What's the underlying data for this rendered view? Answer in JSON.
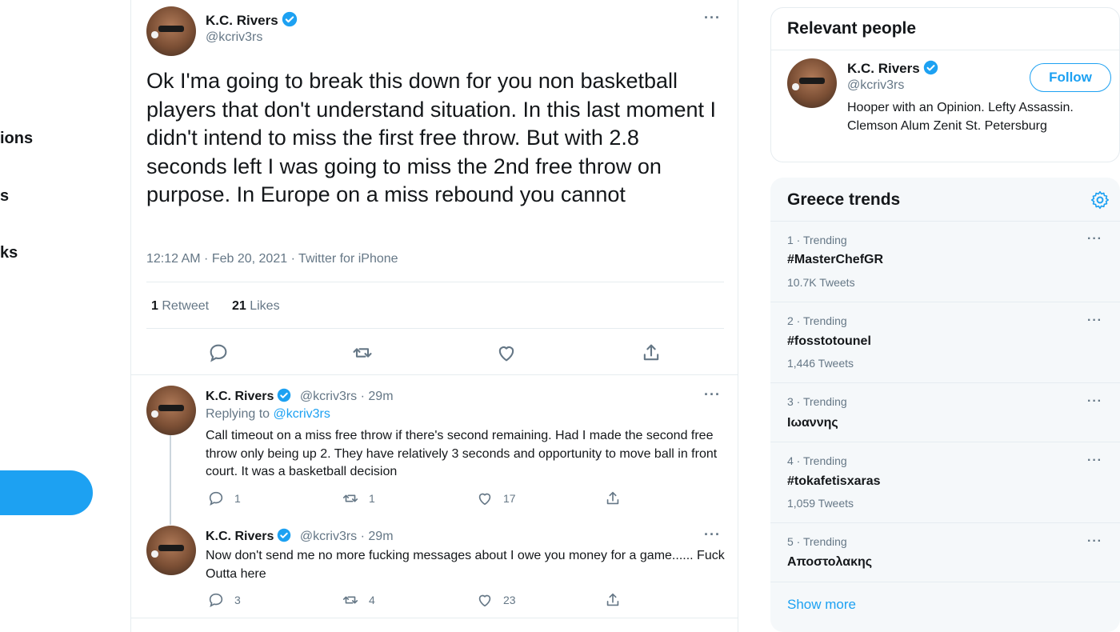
{
  "left_nav": {
    "items": [
      "ions",
      "s",
      "ks"
    ]
  },
  "main_tweet": {
    "author_name": "K.C. Rivers",
    "author_handle": "@kcriv3rs",
    "more": "···",
    "text": "Ok I'ma going to break this down for you non basketball players that don't understand situation. In this last moment I didn't intend to miss the first free throw. But with 2.8 seconds left I was going to miss the 2nd free throw on purpose. In Europe on a miss rebound you cannot",
    "timestamp": "12:12 AM · Feb 20, 2021 · Twitter for iPhone",
    "retweets_count": "1",
    "retweets_label": "Retweet",
    "likes_count": "21",
    "likes_label": "Likes"
  },
  "replies": [
    {
      "author_name": "K.C. Rivers",
      "meta": "@kcriv3rs · 29m",
      "replying_prefix": "Replying to ",
      "replying_handle": "@kcriv3rs",
      "text": "Call timeout on a miss free throw if there's second remaining. Had I made the second free throw only being up 2. They have relatively 3 seconds and opportunity to move ball in front court. It was a basketball decision",
      "reply_count": "1",
      "retweet_count": "1",
      "like_count": "17",
      "more": "···"
    },
    {
      "author_name": "K.C. Rivers",
      "meta": "@kcriv3rs · 29m",
      "text": "Now don't send me no more fucking messages about I owe you money for a game...... Fuck Outta here",
      "reply_count": "3",
      "retweet_count": "4",
      "like_count": "23",
      "more": "···"
    }
  ],
  "relevant_people": {
    "title": "Relevant people",
    "name": "K.C. Rivers",
    "handle": "@kcriv3rs",
    "follow_label": "Follow",
    "bio": "Hooper with an Opinion. Lefty Assassin. Clemson Alum Zenit St. Petersburg"
  },
  "trends": {
    "title": "Greece trends",
    "items": [
      {
        "meta": "1 · Trending",
        "name": "#MasterChefGR",
        "count": "10.7K Tweets"
      },
      {
        "meta": "2 · Trending",
        "name": "#fosstotounel",
        "count": "1,446 Tweets"
      },
      {
        "meta": "3 · Trending",
        "name": "Ιωαννης",
        "count": ""
      },
      {
        "meta": "4 · Trending",
        "name": "#tokafetisxaras",
        "count": "1,059 Tweets"
      },
      {
        "meta": "5 · Trending",
        "name": "Αποστολακης",
        "count": ""
      }
    ],
    "more": "···",
    "show_more": "Show more"
  },
  "colors": {
    "accent": "#1da1f2",
    "secondary_text": "#657786",
    "card_bg": "#f5f8fa"
  },
  "icons": [
    "verified-badge-icon",
    "more-icon",
    "reply-icon",
    "retweet-icon",
    "like-icon",
    "share-icon",
    "settings-gear-icon"
  ]
}
